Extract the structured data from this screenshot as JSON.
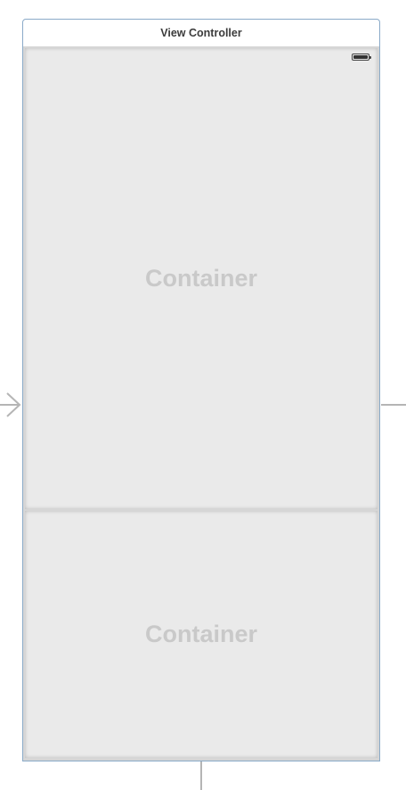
{
  "scene": {
    "title": "View Controller"
  },
  "containers": [
    {
      "label": "Container"
    },
    {
      "label": "Container"
    }
  ],
  "status_bar": {
    "battery": "full"
  },
  "colors": {
    "scene_border": "#8aaac8",
    "container_fill": "#eaeaea",
    "container_label": "#c9c9c9",
    "segue_line": "#b5b5b5"
  },
  "icons": [
    "battery-icon",
    "entry-point-arrow-icon"
  ]
}
